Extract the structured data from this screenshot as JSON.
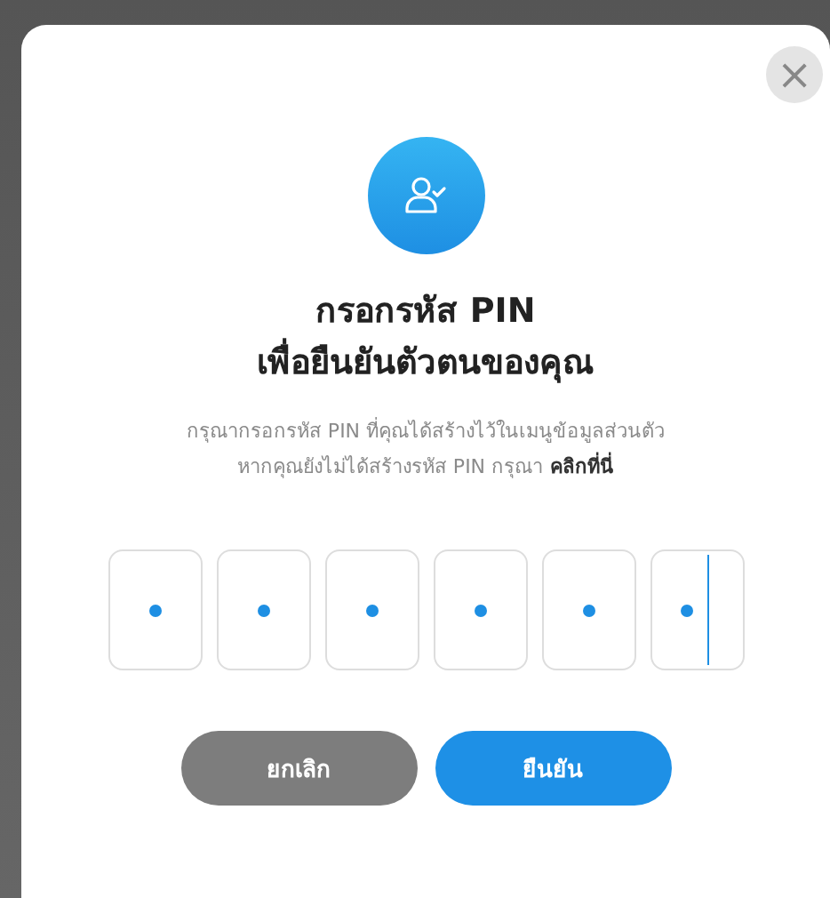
{
  "dialog": {
    "close_button": "×",
    "title_lines": [
      "กรอกรหัส PIN",
      "เพื่อยืนยันตัวตนของคุณ"
    ],
    "description": {
      "line_1": "กรุณากรอกรหัส PIN ที่คุณได้สร้างไว้ในเมนูข้อมูลส่วนตัว",
      "line_2": "หากคุณยังไม่ได้สร้างรหัส PIN กรุณา",
      "link": "คลิกที่นี่"
    },
    "pin_boxes": [
      {
        "filled": true,
        "focused": false
      },
      {
        "filled": true,
        "focused": false
      },
      {
        "filled": true,
        "focused": false
      },
      {
        "filled": true,
        "focused": false
      },
      {
        "filled": true,
        "focused": false
      },
      {
        "filled": true,
        "focused": true
      }
    ],
    "buttons": [
      {
        "label": "ยกเลิก",
        "kind": "cancel"
      },
      {
        "label": "ยืนยัน",
        "kind": "confirm"
      }
    ]
  }
}
